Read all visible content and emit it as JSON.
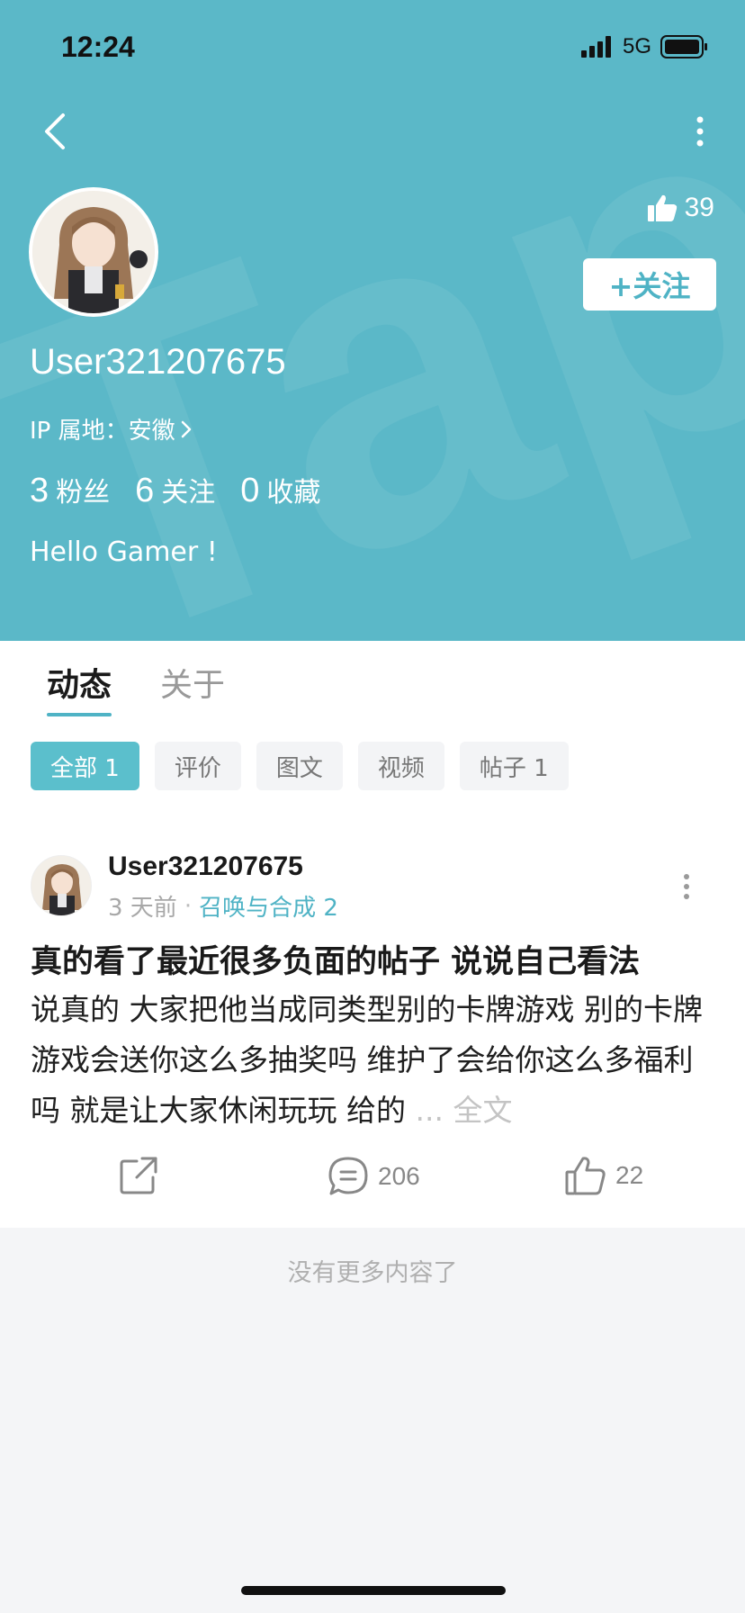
{
  "status": {
    "time": "12:24",
    "network": "5G"
  },
  "profile": {
    "username": "User321207675",
    "ip_label": "IP 属地：安徽",
    "likes": "39",
    "follow_label": "+关注",
    "stats": [
      {
        "num": "3",
        "label": "粉丝"
      },
      {
        "num": "6",
        "label": "关注"
      },
      {
        "num": "0",
        "label": "收藏"
      }
    ],
    "bio": "Hello Gamer !"
  },
  "tabs": [
    {
      "label": "动态"
    },
    {
      "label": "关于"
    }
  ],
  "filters": [
    {
      "label": "全部 1"
    },
    {
      "label": "评价"
    },
    {
      "label": "图文"
    },
    {
      "label": "视频"
    },
    {
      "label": "帖子 1"
    }
  ],
  "post": {
    "username": "User321207675",
    "time": "3 天前",
    "separator": "·",
    "game": "召唤与合成 2",
    "title": "真的看了最近很多负面的帖子 说说自己看法",
    "body": "说真的 大家把他当成同类型别的卡牌游戏 别的卡牌游戏会送你这么多抽奖吗 维护了会给你这么多福利吗 就是让大家休闲玩玩 给的",
    "ellipsis": "...",
    "fulltext": "全文",
    "comments": "206",
    "likes": "22"
  },
  "footer_note": "没有更多内容了",
  "colors": {
    "accent": "#5bb8c8",
    "link": "#4fb3c5"
  },
  "icons": [
    "back-arrow-icon",
    "more-vertical-icon",
    "thumbs-up-icon",
    "share-icon",
    "comment-icon",
    "chevron-right-icon"
  ]
}
